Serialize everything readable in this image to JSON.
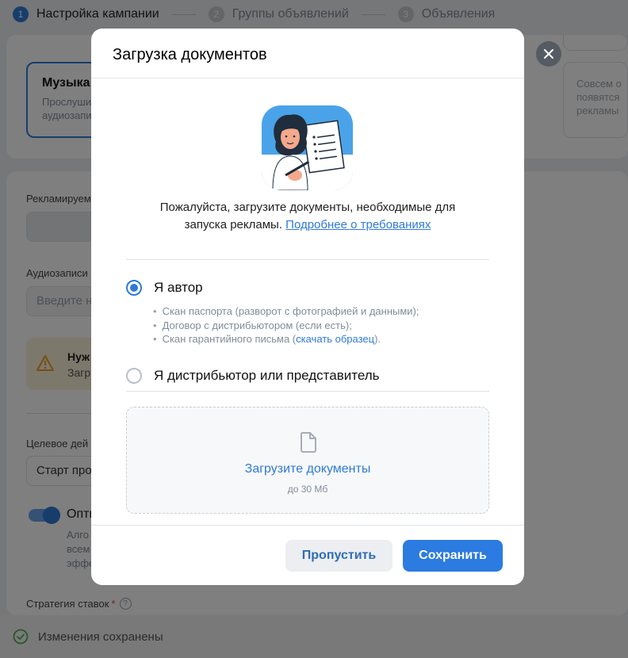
{
  "stepper": {
    "steps": [
      {
        "num": "1",
        "label": "Настройка кампании"
      },
      {
        "num": "2",
        "label": "Группы объявлений"
      },
      {
        "num": "3",
        "label": "Объявления"
      }
    ]
  },
  "background": {
    "music_tile": {
      "title": "Музыка",
      "desc_line1": "Прослуши",
      "desc_line2": "аудиозапи"
    },
    "other_tile": {
      "line1": "Совсем о",
      "line2": "появятся",
      "line3": "рекламы"
    },
    "promoted_label": "Рекламируем",
    "audio_label": "Аудиозаписи",
    "audio_placeholder": "Введите н",
    "warning": {
      "title": "Нуж",
      "text": "Загр"
    },
    "target_label": "Целевое дей",
    "target_value": "Старт про",
    "optimization": {
      "title": "Опти",
      "desc_line1": "Алго",
      "desc_line2": "всем",
      "desc_line3": "эффе"
    },
    "strategy_label": "Стратегия ставок",
    "strategy_required": "*",
    "strategy_help": "?",
    "save_status": "Изменения сохранены"
  },
  "modal": {
    "title": "Загрузка документов",
    "intro_line1": "Пожалуйста, загрузите документы, необходимые для",
    "intro_line2": "запуска рекламы.",
    "intro_link": "Подробнее о требованиях",
    "options": [
      {
        "label": "Я автор",
        "checked": true
      },
      {
        "label": "Я дистрибьютор или представитель",
        "checked": false
      }
    ],
    "requirements": [
      "Скан паспорта (разворот с фотографией и данными);",
      "Договор с дистрибьютором (если есть);"
    ],
    "requirement_3_prefix": "Скан гарантийного письма (",
    "requirement_3_link": "скачать образец",
    "requirement_3_suffix": ").",
    "upload": {
      "title": "Загрузите документы",
      "limit": "до 30 Мб"
    },
    "skip_label": "Пропустить",
    "save_label": "Сохранить"
  },
  "colors": {
    "accent": "#2f7ad6",
    "warning_bg": "#fbf1d9",
    "overlay": "rgba(0,0,0,0.5)"
  },
  "icons": [
    "close-icon",
    "warning-icon",
    "file-icon",
    "check-circle-icon",
    "help-icon"
  ]
}
